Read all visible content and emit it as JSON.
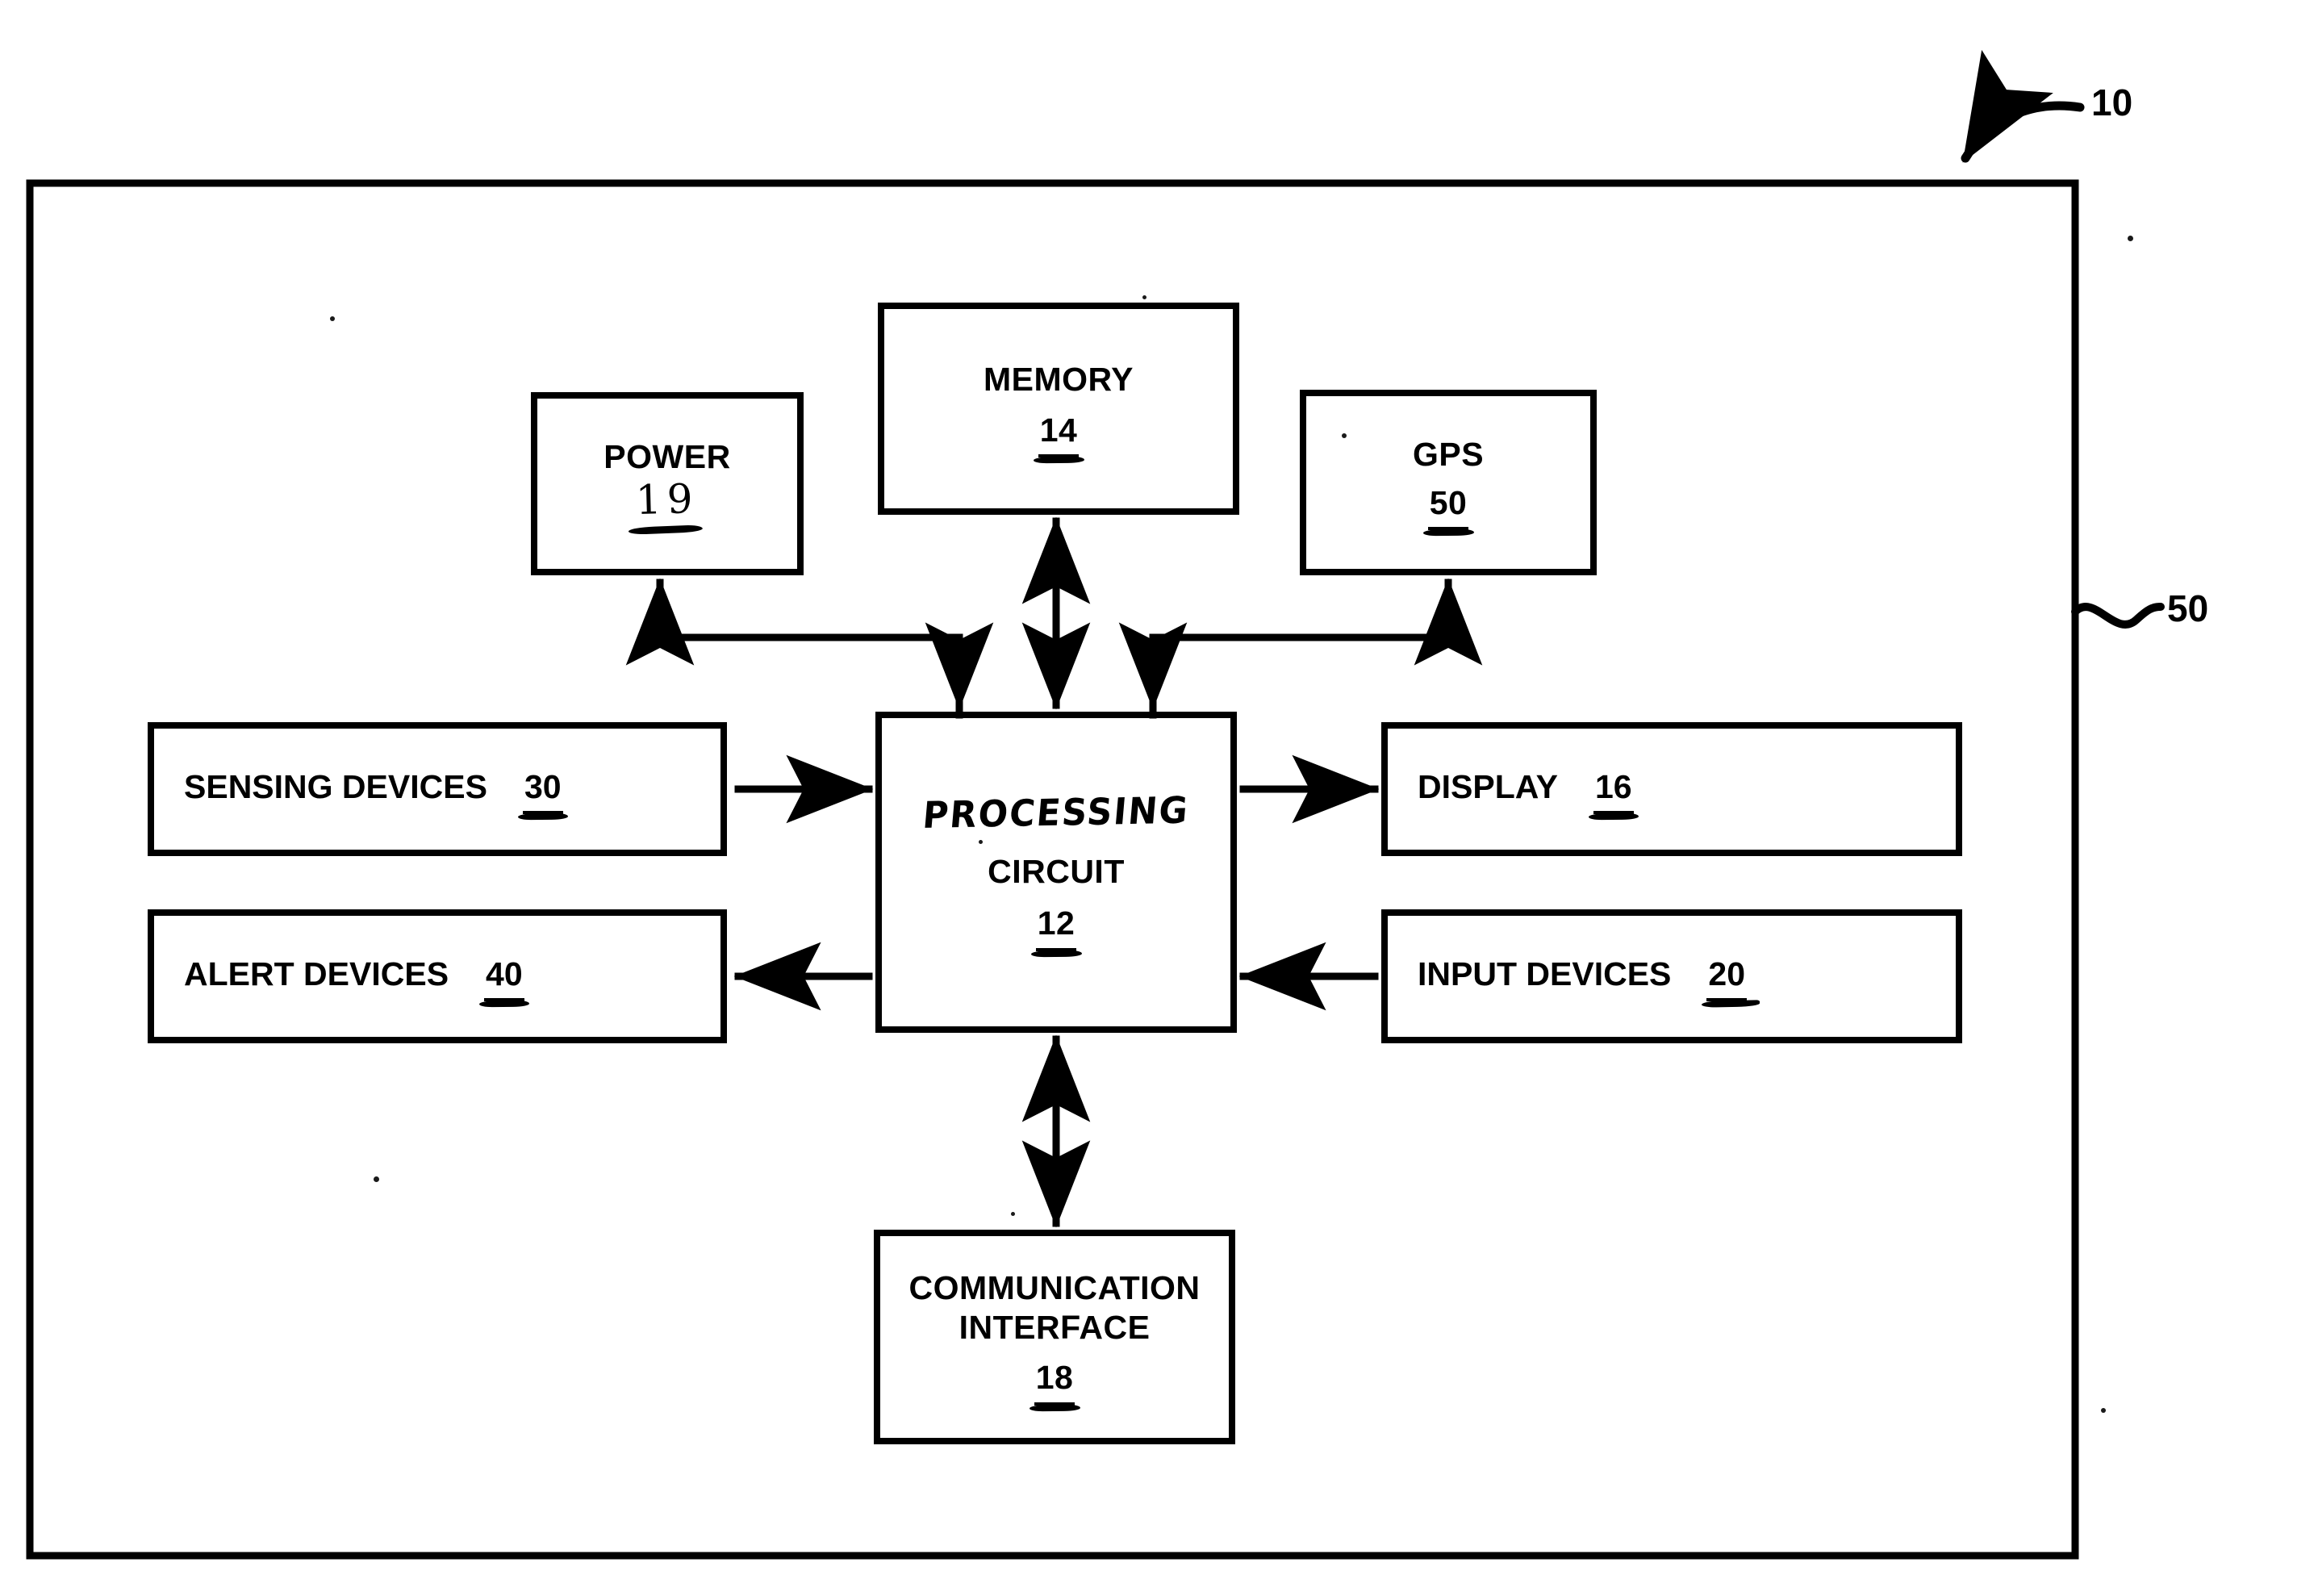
{
  "figure": {
    "type": "patent-block-diagram",
    "device_lead": {
      "label": "10",
      "points_to": "outer-system-boundary"
    },
    "boundary_lead": {
      "label": "50",
      "points_to": "outer-system-boundary-right-edge"
    }
  },
  "blocks": [
    {
      "id": "power",
      "title": "POWER",
      "title2": "",
      "ref": "19",
      "handwritten_title": false,
      "handwritten_ref": true,
      "layout": "stacked"
    },
    {
      "id": "memory",
      "title": "MEMORY",
      "title2": "",
      "ref": "14",
      "handwritten_title": false,
      "handwritten_ref": false,
      "layout": "stacked"
    },
    {
      "id": "gps",
      "title": "GPS",
      "title2": "",
      "ref": "50",
      "handwritten_title": false,
      "handwritten_ref": false,
      "layout": "stacked"
    },
    {
      "id": "processing",
      "title": "PROCESSING",
      "title2": "CIRCUIT",
      "ref": "12",
      "handwritten_title": true,
      "handwritten_ref": false,
      "layout": "stacked"
    },
    {
      "id": "sensing",
      "title": "SENSING DEVICES",
      "title2": "",
      "ref": "30",
      "handwritten_title": false,
      "handwritten_ref": false,
      "layout": "inline"
    },
    {
      "id": "display",
      "title": "DISPLAY",
      "title2": "",
      "ref": "16",
      "handwritten_title": false,
      "handwritten_ref": false,
      "layout": "inline"
    },
    {
      "id": "alert",
      "title": "ALERT DEVICES",
      "title2": "",
      "ref": "40",
      "handwritten_title": false,
      "handwritten_ref": false,
      "layout": "inline"
    },
    {
      "id": "input",
      "title": "INPUT DEVICES",
      "title2": "",
      "ref": "20",
      "handwritten_title": false,
      "handwritten_ref": false,
      "layout": "inline"
    },
    {
      "id": "comm",
      "title": "COMMUNICATION",
      "title2": "INTERFACE",
      "ref": "18",
      "handwritten_title": false,
      "handwritten_ref": false,
      "layout": "stacked"
    }
  ],
  "connectors": [
    {
      "from": "processing",
      "to": "power",
      "direction": "one-way",
      "arrow_at": "power"
    },
    {
      "from": "processing",
      "to": "gps",
      "direction": "one-way",
      "arrow_at": "gps"
    },
    {
      "from": "power",
      "to": "processing",
      "direction": "one-way",
      "arrow_at": "processing"
    },
    {
      "from": "gps",
      "to": "processing",
      "direction": "one-way",
      "arrow_at": "processing"
    },
    {
      "from": "memory",
      "to": "processing",
      "direction": "two-way",
      "arrow_at": "both"
    },
    {
      "from": "sensing",
      "to": "processing",
      "direction": "one-way",
      "arrow_at": "processing"
    },
    {
      "from": "processing",
      "to": "display",
      "direction": "one-way",
      "arrow_at": "display"
    },
    {
      "from": "processing",
      "to": "alert",
      "direction": "one-way",
      "arrow_at": "alert"
    },
    {
      "from": "input",
      "to": "processing",
      "direction": "one-way",
      "arrow_at": "processing"
    },
    {
      "from": "processing",
      "to": "comm",
      "direction": "two-way",
      "arrow_at": "both"
    }
  ],
  "colors": {
    "ink": "#000000",
    "paper": "#ffffff"
  }
}
